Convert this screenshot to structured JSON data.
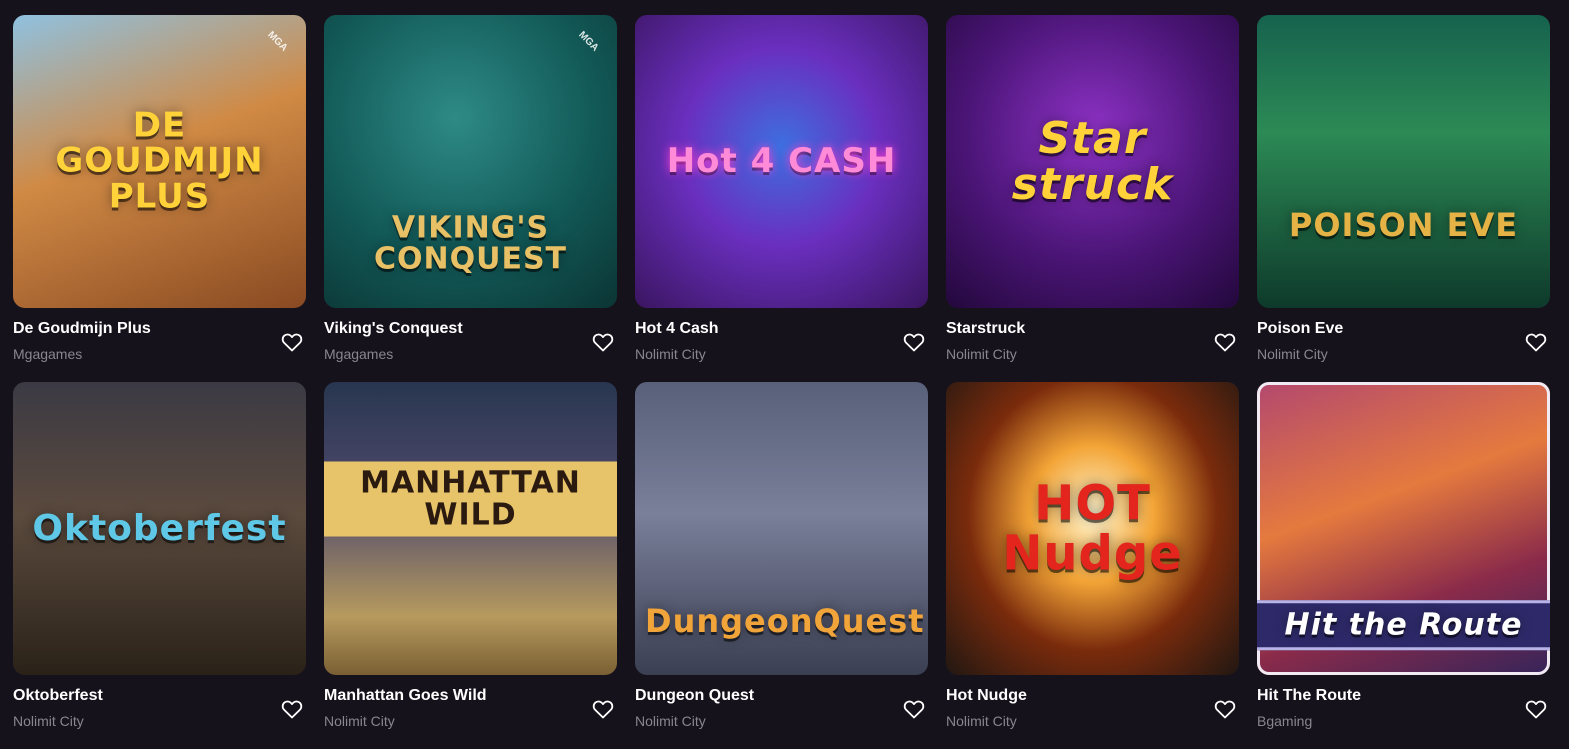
{
  "games": [
    {
      "name": "De Goudmijn Plus",
      "provider": "Mgagames",
      "art_title": "DE GOUDMIJN PLUS",
      "badge": "MGA",
      "title_color": "#ffd23a"
    },
    {
      "name": "Viking's Conquest",
      "provider": "Mgagames",
      "art_title": "VIKING'S CONQUEST",
      "badge": "MGA",
      "title_color": "#e8c065"
    },
    {
      "name": "Hot 4 Cash",
      "provider": "Nolimit City",
      "art_title": "Hot 4 CASH",
      "badge": "",
      "title_color": "#ff8ad8"
    },
    {
      "name": "Starstruck",
      "provider": "Nolimit City",
      "art_title": "Star struck",
      "badge": "",
      "title_color": "#ffd23a"
    },
    {
      "name": "Poison Eve",
      "provider": "Nolimit City",
      "art_title": "POISON EVE",
      "badge": "",
      "title_color": "#e4b245"
    },
    {
      "name": "Oktoberfest",
      "provider": "Nolimit City",
      "art_title": "Oktoberfest",
      "badge": "",
      "title_color": "#5ec8e6"
    },
    {
      "name": "Manhattan Goes Wild",
      "provider": "Nolimit City",
      "art_title": "MANHATTAN WILD",
      "badge": "",
      "title_color": "#2b1a10"
    },
    {
      "name": "Dungeon Quest",
      "provider": "Nolimit City",
      "art_title": "DungeonQuest",
      "badge": "",
      "title_color": "#f0a43a"
    },
    {
      "name": "Hot Nudge",
      "provider": "Nolimit City",
      "art_title": "HOT Nudge",
      "badge": "",
      "title_color": "#e3251d"
    },
    {
      "name": "Hit The Route",
      "provider": "Bgaming",
      "art_title": "Hit the Route",
      "badge": "",
      "title_color": "#ffffff"
    }
  ],
  "icons": {
    "favorite": "heart-outline-icon"
  }
}
